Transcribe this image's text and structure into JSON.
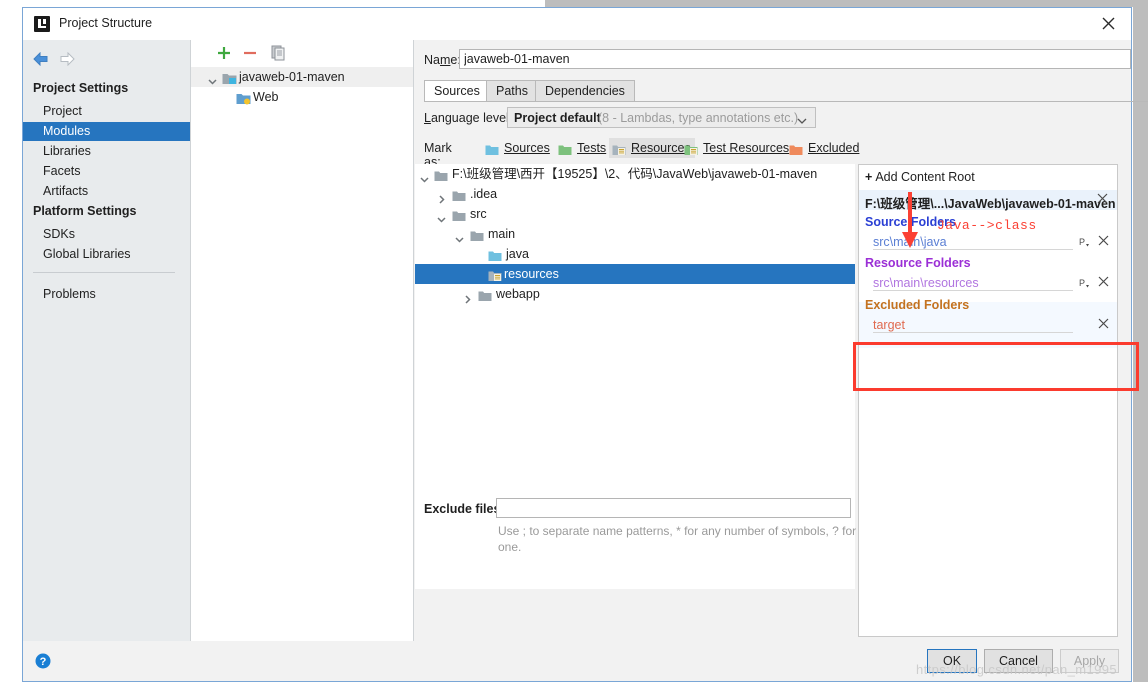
{
  "window": {
    "title": "Project Structure",
    "app_icon": "intellij-idea-icon",
    "close_icon": "close-icon"
  },
  "nav": {
    "back_icon": "back-arrow-icon",
    "forward_icon": "forward-arrow-icon",
    "sections": [
      {
        "label": "Project Settings",
        "items": [
          {
            "label": "Project",
            "selected": false
          },
          {
            "label": "Modules",
            "selected": true
          },
          {
            "label": "Libraries",
            "selected": false
          },
          {
            "label": "Facets",
            "selected": false
          },
          {
            "label": "Artifacts",
            "selected": false
          }
        ]
      },
      {
        "label": "Platform Settings",
        "items": [
          {
            "label": "SDKs",
            "selected": false
          },
          {
            "label": "Global Libraries",
            "selected": false
          }
        ]
      }
    ],
    "problems": {
      "label": "Problems"
    }
  },
  "modules": {
    "toolbar": {
      "add_icon": "plus-icon",
      "remove_icon": "minus-icon",
      "copy_icon": "copy-icon"
    },
    "tree": [
      {
        "label": "javaweb-01-maven",
        "icon": "module-folder-icon",
        "expanded": true,
        "selected": true,
        "depth": 0
      },
      {
        "label": "Web",
        "icon": "web-facet-icon",
        "expanded": null,
        "selected": false,
        "depth": 1
      }
    ]
  },
  "module_editor": {
    "name_label": "Name:",
    "name_value": "javaweb-01-maven",
    "tabs": [
      {
        "label": "Sources",
        "active": true
      },
      {
        "label": "Paths",
        "active": false
      },
      {
        "label": "Dependencies",
        "active": false
      }
    ],
    "language_level": {
      "label": "Language level:",
      "value": "Project default",
      "value_hint": "(8 - Lambdas, type annotations etc.)",
      "chevron_icon": "chevron-down-icon"
    },
    "mark_as": {
      "label": "Mark as:",
      "options": [
        {
          "label": "Sources",
          "icon": "sources-folder-icon",
          "color": "#6fc0e0",
          "pressed": false
        },
        {
          "label": "Tests",
          "icon": "tests-folder-icon",
          "color": "#7dc17d",
          "pressed": false
        },
        {
          "label": "Resources",
          "icon": "resources-folder-icon",
          "color": "#a6b3bd",
          "pressed": true
        },
        {
          "label": "Test Resources",
          "icon": "test-resources-folder-icon",
          "color": "#7dc17d",
          "pressed": false
        },
        {
          "label": "Excluded",
          "icon": "excluded-folder-icon",
          "color": "#ef8a5c",
          "pressed": false
        }
      ]
    },
    "content_tree": [
      {
        "label": "F:\\班级管理\\西开【19525】\\2、代码\\JavaWeb\\javaweb-01-maven",
        "depth": 0,
        "expanded": true,
        "icon": "folder-icon",
        "selected": false
      },
      {
        "label": ".idea",
        "depth": 1,
        "expanded": false,
        "icon": "folder-icon",
        "selected": false
      },
      {
        "label": "src",
        "depth": 1,
        "expanded": true,
        "icon": "folder-icon",
        "selected": false
      },
      {
        "label": "main",
        "depth": 2,
        "expanded": true,
        "icon": "folder-icon",
        "selected": false
      },
      {
        "label": "java",
        "depth": 3,
        "expanded": null,
        "icon": "sources-folder-icon",
        "selected": false
      },
      {
        "label": "resources",
        "depth": 3,
        "expanded": null,
        "icon": "resources-folder-icon",
        "selected": true
      },
      {
        "label": "webapp",
        "depth": 2,
        "expanded": false,
        "icon": "folder-icon",
        "selected": false
      }
    ],
    "exclude_files": {
      "label": "Exclude files:",
      "value": "",
      "hint": "Use ; to separate name patterns, * for any number of symbols, ? for one."
    }
  },
  "details": {
    "add_content_root": {
      "label": "Add Content Root",
      "plus": "+",
      "icon": "plus-icon"
    },
    "content_root": {
      "path": "F:\\班级管理\\...\\JavaWeb\\javaweb-01-maven",
      "remove_icon": "close-icon"
    },
    "groups": [
      {
        "title": "Source Folders",
        "color": "#2a3fd4",
        "entries": [
          {
            "path": "src\\main\\java",
            "color": "#5b7fd4",
            "package_icon": "package-prefix-icon",
            "remove_icon": "close-icon"
          }
        ]
      },
      {
        "title": "Resource Folders",
        "color": "#9b2fd6",
        "entries": [
          {
            "path": "src\\main\\resources",
            "color": "#b175e0",
            "package_icon": "package-prefix-icon",
            "remove_icon": "close-icon"
          }
        ]
      },
      {
        "title": "Excluded Folders",
        "color": "#c4721f",
        "entries": [
          {
            "path": "target",
            "color": "#e06a4f",
            "package_icon": "",
            "remove_icon": "close-icon"
          }
        ]
      }
    ],
    "annotation": {
      "text": "Java-->class",
      "color": "#fb4034",
      "arrow_icon": "down-arrow-annotation-icon",
      "highlight_color": "#fb3b2e"
    }
  },
  "footer": {
    "help_icon": "help-icon",
    "buttons": [
      {
        "label": "OK",
        "kind": "default"
      },
      {
        "label": "Cancel",
        "kind": "normal"
      },
      {
        "label": "Apply",
        "kind": "disabled"
      }
    ]
  },
  "watermark": {
    "text": "https://blog.csdn.net/pan_m1995"
  }
}
